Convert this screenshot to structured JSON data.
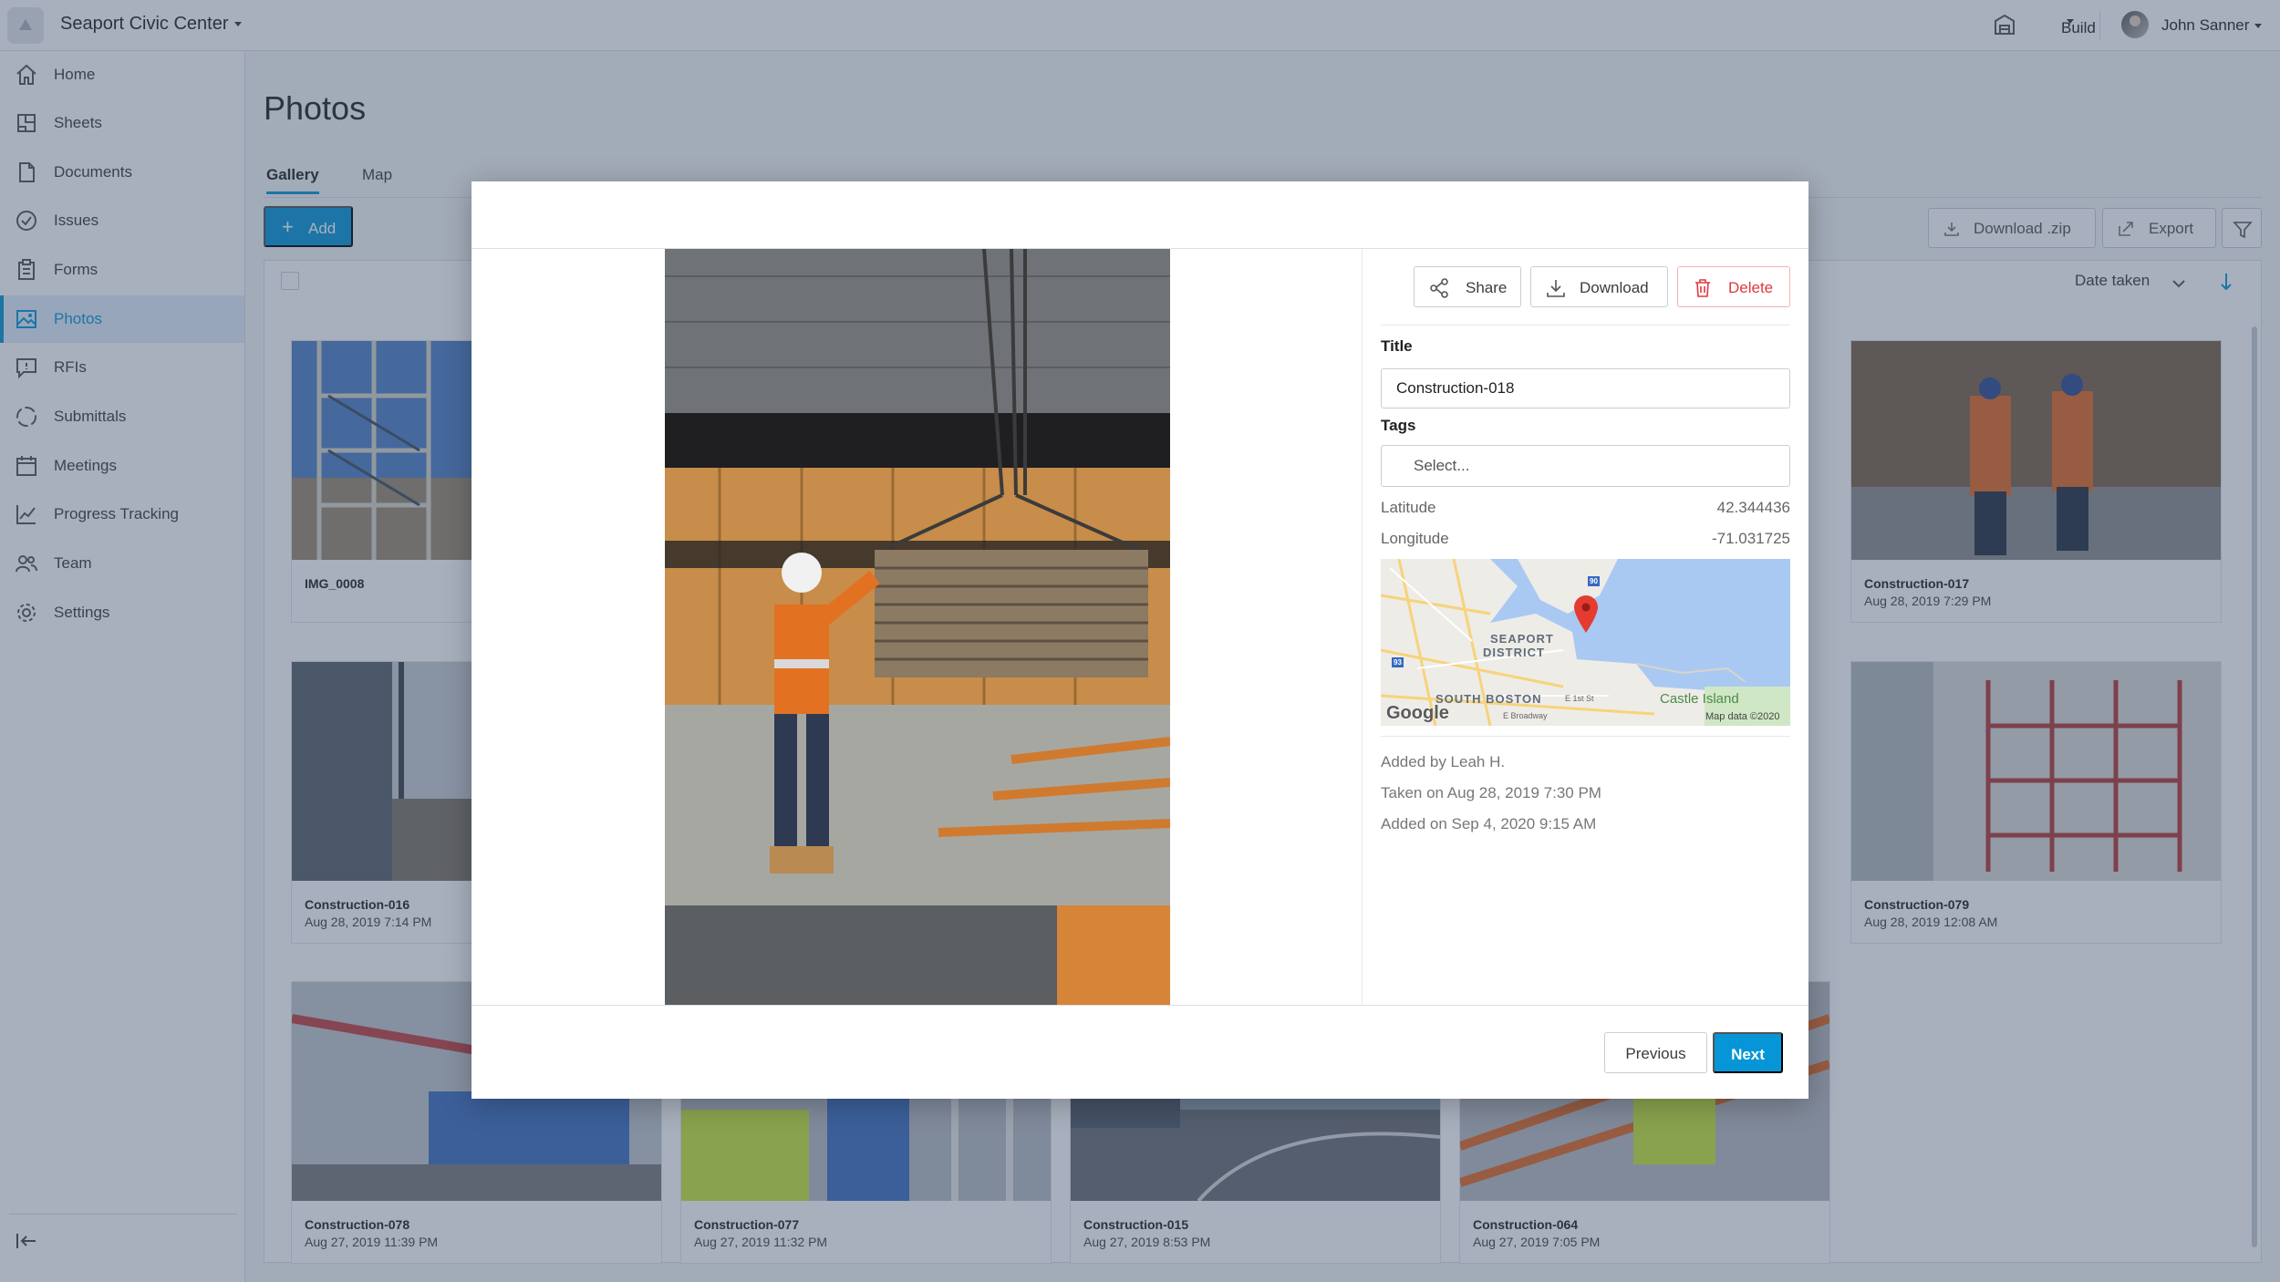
{
  "header": {
    "project_name": "Seaport Civic Center",
    "module_label": "Build",
    "user_name": "John Sanner"
  },
  "sidebar": {
    "items": [
      {
        "label": "Home",
        "icon": "home-icon"
      },
      {
        "label": "Sheets",
        "icon": "sheets-icon"
      },
      {
        "label": "Documents",
        "icon": "documents-icon"
      },
      {
        "label": "Issues",
        "icon": "issues-icon"
      },
      {
        "label": "Forms",
        "icon": "forms-icon"
      },
      {
        "label": "Photos",
        "icon": "photos-icon",
        "active": true
      },
      {
        "label": "RFIs",
        "icon": "rfis-icon"
      },
      {
        "label": "Submittals",
        "icon": "submittals-icon"
      },
      {
        "label": "Meetings",
        "icon": "meetings-icon"
      },
      {
        "label": "Progress Tracking",
        "icon": "progress-tracking-icon"
      },
      {
        "label": "Team",
        "icon": "team-icon"
      },
      {
        "label": "Settings",
        "icon": "settings-icon"
      }
    ]
  },
  "page": {
    "title": "Photos",
    "tabs": [
      {
        "label": "Gallery",
        "active": true
      },
      {
        "label": "Map"
      }
    ],
    "add_label": "Add",
    "download_zip_label": "Download .zip",
    "export_label": "Export",
    "sort_label": "Date taken"
  },
  "gallery": {
    "cards": [
      {
        "name": "IMG_0008",
        "date": ""
      },
      {
        "name": "Construction-017",
        "date": "Aug 28, 2019 7:29 PM"
      },
      {
        "name": "Construction-016",
        "date": "Aug 28, 2019 7:14 PM"
      },
      {
        "name": "Construction-079",
        "date": "Aug 28, 2019 12:08 AM"
      },
      {
        "name": "Construction-078",
        "date": "Aug 27, 2019 11:39 PM"
      },
      {
        "name": "Construction-077",
        "date": "Aug 27, 2019 11:32 PM"
      },
      {
        "name": "Construction-015",
        "date": "Aug 27, 2019 8:53 PM"
      },
      {
        "name": "Construction-064",
        "date": "Aug 27, 2019 7:05 PM"
      }
    ]
  },
  "modal": {
    "share_label": "Share",
    "download_label": "Download",
    "delete_label": "Delete",
    "title_label": "Title",
    "title_value": "Construction-018",
    "tags_label": "Tags",
    "tags_placeholder": "Select...",
    "latitude_label": "Latitude",
    "latitude_value": "42.344436",
    "longitude_label": "Longitude",
    "longitude_value": "-71.031725",
    "map": {
      "district": "SEAPORT",
      "district2": "DISTRICT",
      "south_boston": "SOUTH BOSTON",
      "castle_island": "Castle Island",
      "google": "Google",
      "map_data": "Map data ©2020",
      "broadway": "E Broadway",
      "first_st": "E 1st St",
      "shield_90": "90",
      "shield_93": "93"
    },
    "added_by": "Added by Leah H.",
    "taken_on": "Taken on Aug 28, 2019 7:30 PM",
    "added_on": "Added on Sep 4, 2020 9:15 AM",
    "previous_label": "Previous",
    "next_label": "Next"
  },
  "colors": {
    "accent": "#0696d7",
    "danger": "#e0383e",
    "overlay": "#384c68"
  }
}
